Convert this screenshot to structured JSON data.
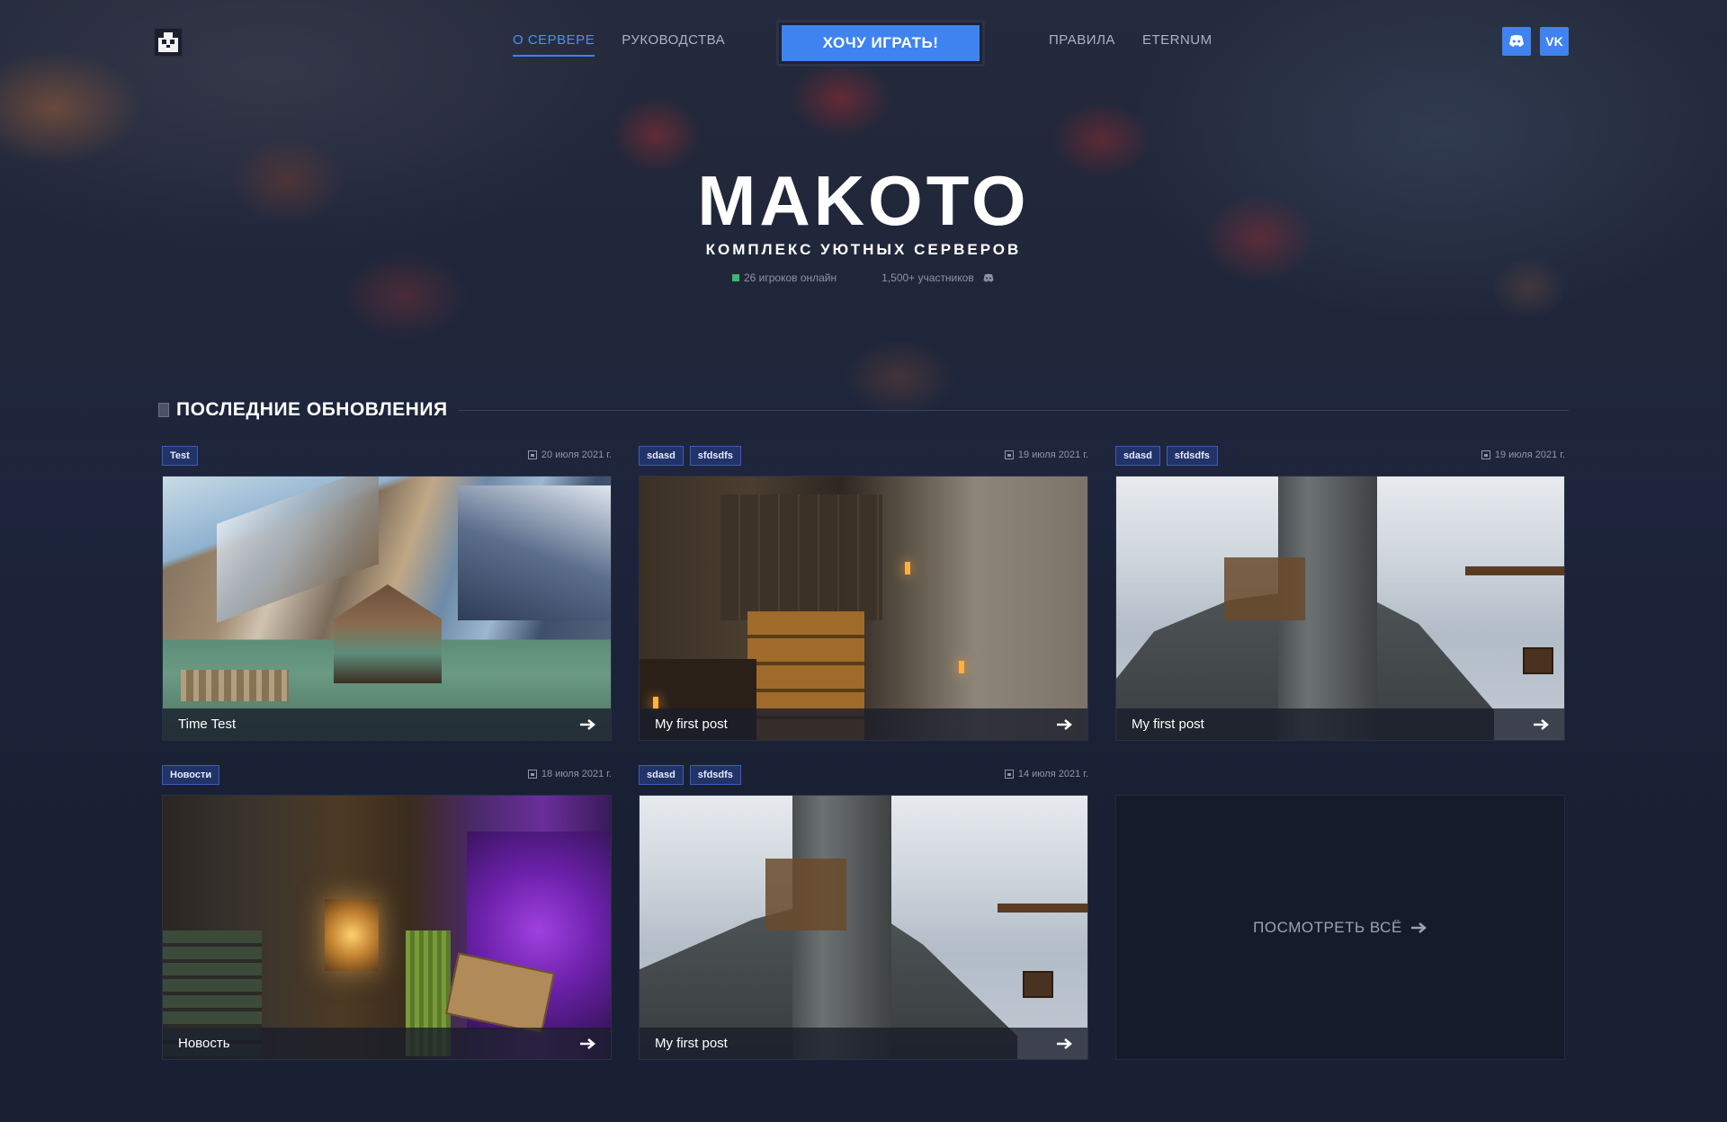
{
  "header": {
    "nav_left": [
      {
        "label": "О СЕРВЕРЕ",
        "active": true
      },
      {
        "label": "РУКОВОДСТВА",
        "active": false
      }
    ],
    "play_button": "ХОЧУ ИГРАТЬ!",
    "nav_right": [
      {
        "label": "ПРАВИЛА"
      },
      {
        "label": "ETERNUM"
      }
    ],
    "socials": [
      {
        "icon": "discord-icon"
      },
      {
        "icon": "vk-icon",
        "text": "VK"
      }
    ]
  },
  "hero": {
    "title": "MAKOTO",
    "subtitle": "КОМПЛЕКС УЮТНЫХ СЕРВЕРОВ",
    "online": "26 игроков онлайн",
    "members": "1,500+ участников"
  },
  "section": {
    "title": "ПОСЛЕДНИЕ ОБНОВЛЕНИЯ"
  },
  "posts": [
    {
      "tags": [
        "Test"
      ],
      "date": "20 июля 2021 г.",
      "title": "Time Test",
      "scene": "scene-1"
    },
    {
      "tags": [
        "sdasd",
        "sfdsdfs"
      ],
      "date": "19 июля 2021 г.",
      "title": "My first post",
      "scene": "scene-2"
    },
    {
      "tags": [
        "sdasd",
        "sfdsdfs"
      ],
      "date": "19 июля 2021 г.",
      "title": "My first post",
      "scene": "scene-3"
    },
    {
      "tags": [
        "Новости"
      ],
      "date": "18 июля 2021 г.",
      "title": "Новость",
      "scene": "scene-4"
    },
    {
      "tags": [
        "sdasd",
        "sfdsdfs"
      ],
      "date": "14 июля 2021 г.",
      "title": "My first post",
      "scene": "scene-5"
    }
  ],
  "view_all": "ПОСМОТРЕТЬ ВСЁ",
  "colors": {
    "accent": "#3f83f0",
    "background": "#1a2034",
    "tag_bg": "#22336a",
    "online": "#3fb46b"
  }
}
